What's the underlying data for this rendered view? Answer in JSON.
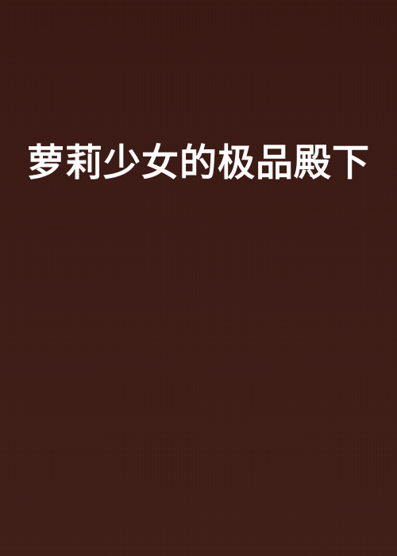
{
  "cover": {
    "title": "萝莉少女的极品殿下",
    "background_color": "#3c1c16",
    "text_color": "#ffffff"
  }
}
